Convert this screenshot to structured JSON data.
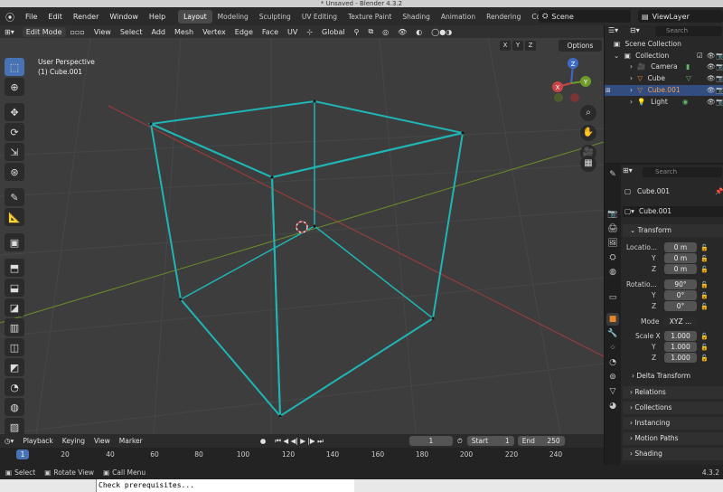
{
  "window": {
    "title": "* Unsaved - Blender 4.3.2"
  },
  "menu": [
    "File",
    "Edit",
    "Render",
    "Window",
    "Help"
  ],
  "workspaces": [
    "Layout",
    "Modeling",
    "Sculpting",
    "UV Editing",
    "Texture Paint",
    "Shading",
    "Animation",
    "Rendering",
    "Compositing"
  ],
  "active_workspace": "Layout",
  "scene": "Scene",
  "view_layer": "ViewLayer",
  "viewport_header": {
    "mode": "Edit Mode",
    "menus": [
      "View",
      "Select",
      "Add",
      "Mesh",
      "Vertex",
      "Edge",
      "Face",
      "UV"
    ],
    "orientation": "Global",
    "axes": [
      "X",
      "Y",
      "Z"
    ],
    "options": "Options"
  },
  "viewport": {
    "perspective_label": "User Perspective",
    "object_label": "(1) Cube.001",
    "gizmo": {
      "x": "X",
      "y": "Y",
      "z": "Z"
    },
    "wire_color": "#1fb5b5",
    "background": "#3d3d3d"
  },
  "timeline": {
    "menus": [
      "Playback",
      "Keying",
      "View",
      "Marker"
    ],
    "current_frame": "1",
    "start_label": "Start",
    "start": "1",
    "end_label": "End",
    "end": "250",
    "ruler": [
      "1",
      "20",
      "40",
      "60",
      "80",
      "100",
      "120",
      "140",
      "160",
      "180",
      "200",
      "220",
      "240"
    ]
  },
  "status": {
    "select": "Select",
    "rotate": "Rotate View",
    "menu": "Call Menu",
    "version": "4.3.2"
  },
  "terminal": {
    "text": "Check prerequisites..."
  },
  "outliner": {
    "search_placeholder": "Search",
    "root": "Scene Collection",
    "collection": "Collection",
    "items": [
      {
        "name": "Camera",
        "selected": false
      },
      {
        "name": "Cube",
        "selected": false
      },
      {
        "name": "Cube.001",
        "selected": true
      },
      {
        "name": "Light",
        "selected": false
      }
    ]
  },
  "properties": {
    "search_placeholder": "Search",
    "object_name": "Cube.001",
    "datablock": "Cube.001",
    "transform_title": "Transform",
    "location_label": "Locatio...",
    "location": [
      "0 m",
      "0 m",
      "0 m"
    ],
    "rotation_label": "Rotatio...",
    "rotation": [
      "90°",
      "0°",
      "0°"
    ],
    "mode_label": "Mode",
    "mode_value": "XYZ ...",
    "scale_label": "Scale X",
    "scale": [
      "1.000",
      "1.000",
      "1.000"
    ],
    "axis_y": "Y",
    "axis_z": "Z",
    "delta_transform": "Delta Transform",
    "panels": [
      "Relations",
      "Collections",
      "Instancing",
      "Motion Paths",
      "Shading"
    ]
  }
}
